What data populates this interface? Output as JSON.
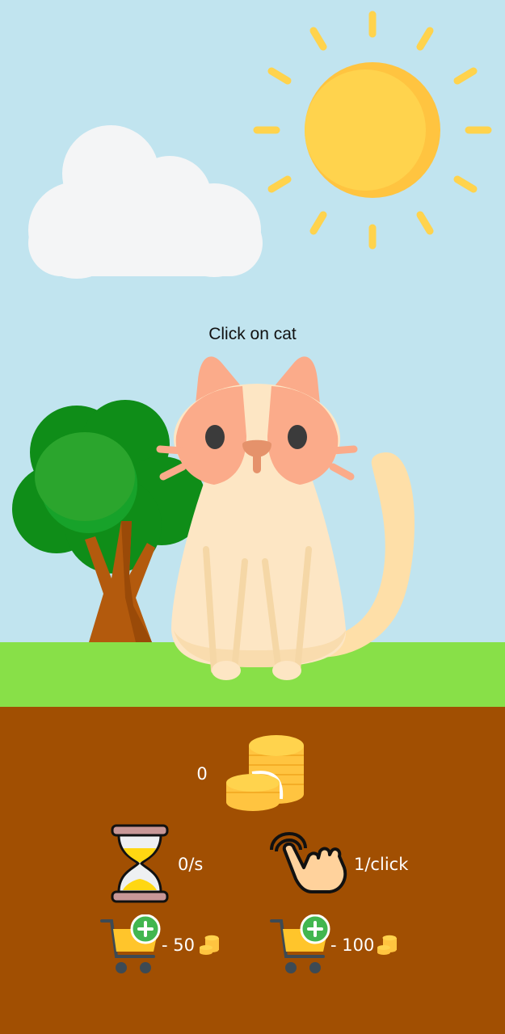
{
  "hint": "Click on cat",
  "stats": {
    "coins": "0",
    "per_second": "0/s",
    "per_click": "1/click"
  },
  "shop": {
    "auto_price": "- 50",
    "click_price": "- 100"
  },
  "colors": {
    "sky": "#c1e4ef",
    "grass": "#88e048",
    "soil": "#a14f02",
    "sun": "#ffd34d",
    "cat_body": "#fde6c4",
    "cat_patch": "#fbab8a",
    "coin": "#ffd34d"
  },
  "icons": [
    "sun-icon",
    "cloud-icon",
    "tree-icon",
    "cat-icon",
    "coin-stack-icon",
    "hourglass-icon",
    "tap-hand-icon",
    "cart-plus-icon",
    "coin-icon"
  ]
}
